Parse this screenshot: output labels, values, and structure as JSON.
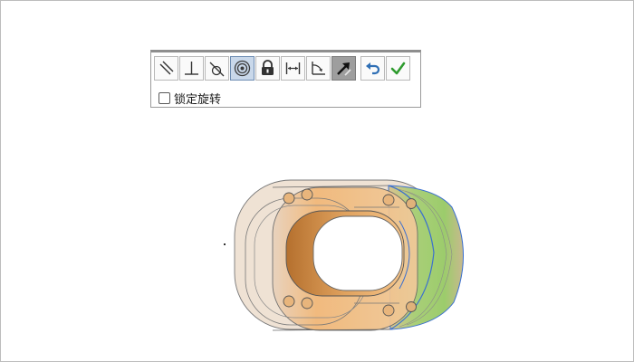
{
  "toolbar": {
    "buttons": [
      {
        "id": "parallel",
        "icon": "parallel-icon",
        "active": false
      },
      {
        "id": "perpendicular",
        "icon": "perpendicular-icon",
        "active": false
      },
      {
        "id": "tangent",
        "icon": "tangent-icon",
        "active": false
      },
      {
        "id": "concentric",
        "icon": "concentric-icon",
        "active": true
      },
      {
        "id": "lock",
        "icon": "lock-icon",
        "active": false
      },
      {
        "id": "distance",
        "icon": "distance-icon",
        "active": false
      },
      {
        "id": "angle",
        "icon": "angle-icon",
        "active": false
      },
      {
        "id": "flip-alignment",
        "icon": "flip-alignment-icon",
        "active": true
      },
      {
        "id": "undo",
        "icon": "undo-icon",
        "active": false
      },
      {
        "id": "ok",
        "icon": "checkmark-icon",
        "active": false
      }
    ],
    "lock_rotation_label": "锁定旋转",
    "lock_rotation_checked": false
  },
  "colors": {
    "concentric_highlight": "#c9d8ea",
    "part_orange": "#f0b46e",
    "face_green": "#9ccc6c",
    "edge_blue": "#3a6fd0",
    "checkmark": "#2e9b2e",
    "undo": "#2f6fb5"
  }
}
